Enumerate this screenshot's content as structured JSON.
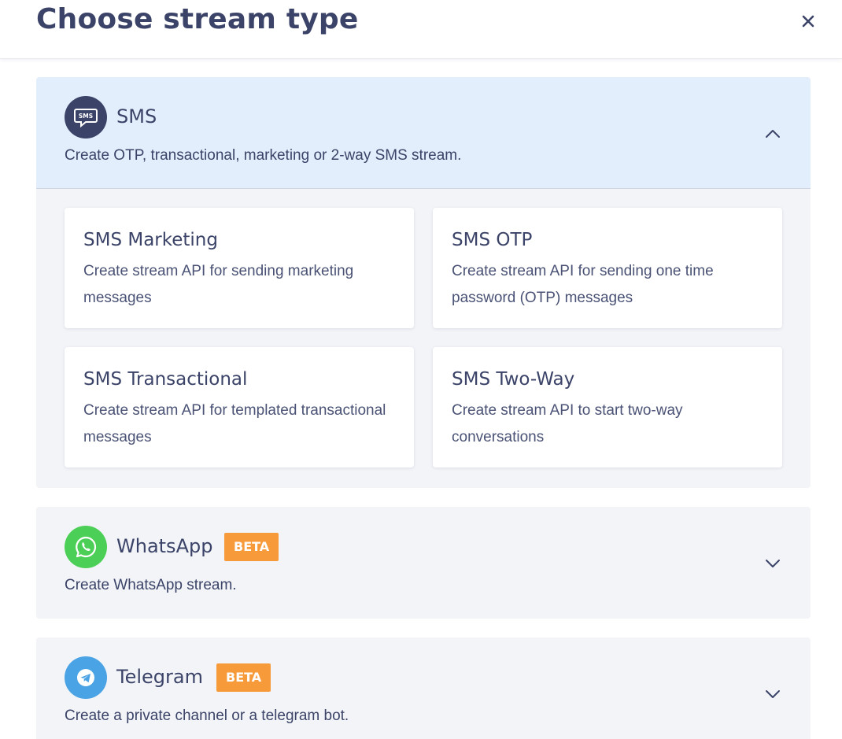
{
  "dialog": {
    "title": "Choose stream type"
  },
  "sections": {
    "sms": {
      "title": "SMS",
      "description": "Create OTP, transactional, marketing or 2-way SMS stream.",
      "icon": "sms-chat-icon",
      "icon_color": "#3b4468",
      "expanded": true,
      "options": [
        {
          "title": "SMS Marketing",
          "description": "Create stream API for sending marketing messages"
        },
        {
          "title": "SMS OTP",
          "description": "Create stream API for sending one time password (OTP) messages"
        },
        {
          "title": "SMS Transactional",
          "description": "Create stream API for templated transactional messages"
        },
        {
          "title": "SMS Two-Way",
          "description": "Create stream API to start two-way conversations"
        }
      ]
    },
    "whatsapp": {
      "title": "WhatsApp",
      "badge": "BETA",
      "description": "Create WhatsApp stream.",
      "icon": "whatsapp-icon",
      "icon_color": "#4ccf56",
      "expanded": false
    },
    "telegram": {
      "title": "Telegram",
      "badge": "BETA",
      "description": "Create a private channel or a telegram bot.",
      "icon": "telegram-icon",
      "icon_color": "#4aa3e4",
      "expanded": false
    }
  },
  "colors": {
    "text": "#3b4468",
    "badge": "#f79a3a",
    "expanded_header": "#e3eefc",
    "section_bg": "#f3f4f8"
  }
}
